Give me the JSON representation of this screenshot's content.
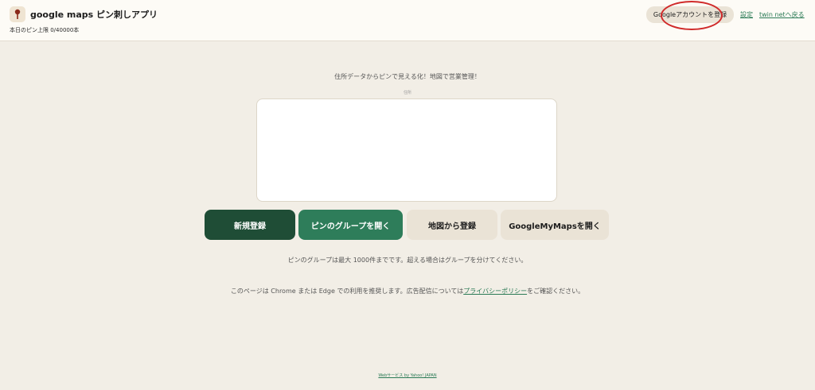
{
  "header": {
    "app_icon": "pin-icon",
    "app_title": "google maps ピン刺しアプリ",
    "pin_count": "本日のピン上限 0/40000本",
    "google_button_label": "Googleアカウントを登録",
    "settings_link": "設定",
    "back_link": "twin netへ戻る"
  },
  "main": {
    "tagline": "住所データからピンで見える化！地図で営業管理！",
    "field_label": "住所",
    "address_value": "",
    "buttons": {
      "new": "新規登録",
      "group": "ピンのグループを開く",
      "from_map": "地図から登録",
      "mymaps": "GoogleMyMapsを開く"
    },
    "note": "ピンのグループは最大 1000件までです。超える場合はグループを分けてください。",
    "notice_before": "このページは Chrome または Edge での利用を推奨します。広告配信については",
    "notice_link": "プライバシーポリシー",
    "notice_after": "をご確認ください。"
  },
  "footer": {
    "credit": "Webサービス by Yahoo! JAPAN"
  },
  "colors": {
    "primary_dark": "#1f4d36",
    "primary": "#2e7d5a",
    "secondary": "#eae3d6",
    "background": "#f2eee6",
    "highlight": "#d02a2a"
  }
}
